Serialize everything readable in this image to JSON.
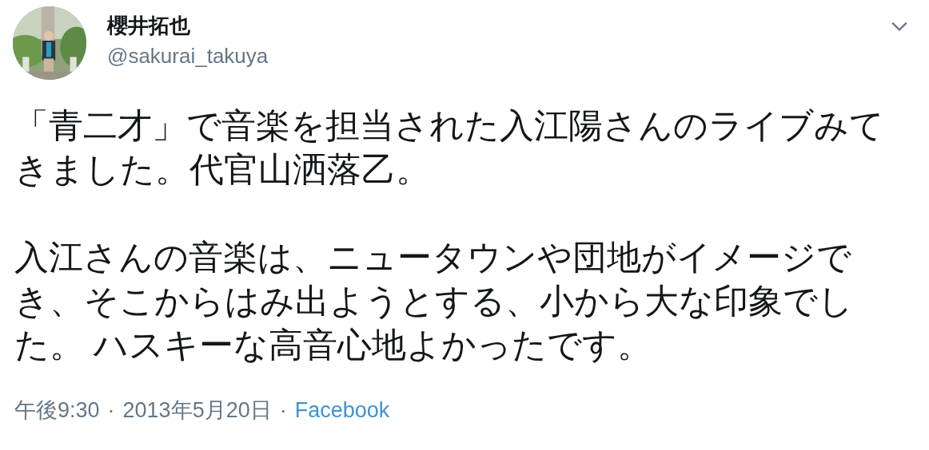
{
  "tweet": {
    "author": {
      "name": "櫻井拓也",
      "handle": "@sakurai_takuya"
    },
    "paragraphs": [
      "「青二才」で音楽を担当された入江陽さんのライブみてきました。代官山洒落乙。",
      "入江さんの音楽は、ニュータウンや団地がイメージでき、そこからはみ出ようとする、小から大な印象でした。 ハスキーな高音心地よかったです。"
    ],
    "footer": {
      "time": "午後9:30",
      "separator_1": "·",
      "date": "2013年5月20日",
      "separator_2": "·",
      "source": "Facebook"
    }
  }
}
